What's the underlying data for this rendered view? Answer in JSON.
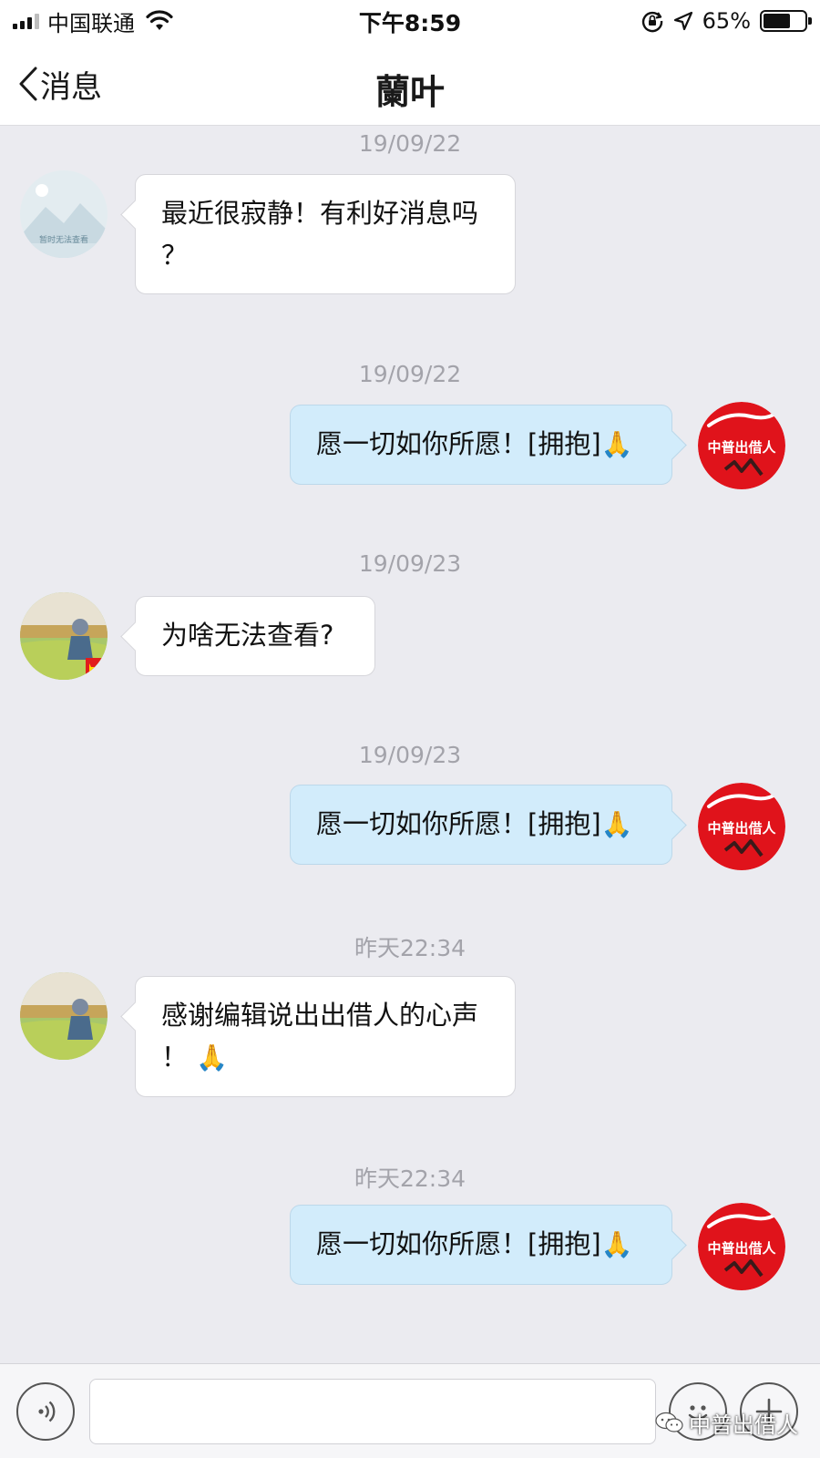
{
  "status_bar": {
    "carrier": "中国联通",
    "time": "下午8:59",
    "battery_percent": "65%",
    "battery_level": 0.65
  },
  "nav": {
    "back_label": "消息",
    "title": "蘭叶"
  },
  "messages": [
    {
      "timestamp": "19/09/22",
      "direction": "incoming",
      "avatar": "placeholder-image-avatar",
      "avatar_text": "暂时无法查看",
      "lines": [
        "最近很寂静！有利好消息吗",
        "？"
      ]
    },
    {
      "timestamp": "19/09/22",
      "direction": "outgoing",
      "avatar": "red-logo-avatar",
      "lines": [
        "愿一切如你所愿！[拥抱]"
      ],
      "emoji": "🙏"
    },
    {
      "timestamp": "19/09/23",
      "direction": "incoming",
      "avatar": "wheat-field-avatar",
      "lines": [
        "为啥无法查看?"
      ]
    },
    {
      "timestamp": "19/09/23",
      "direction": "outgoing",
      "avatar": "red-logo-avatar",
      "lines": [
        "愿一切如你所愿！[拥抱]"
      ],
      "emoji": "🙏"
    },
    {
      "timestamp": "昨天22:34",
      "direction": "incoming",
      "avatar": "wheat-field-avatar",
      "lines": [
        "感谢编辑说出出借人的心声",
        "！"
      ],
      "emoji": "🙏"
    },
    {
      "timestamp": "昨天22:34",
      "direction": "outgoing",
      "avatar": "red-logo-avatar",
      "lines": [
        "愿一切如你所愿！[拥抱]"
      ],
      "emoji": "🙏"
    }
  ],
  "logo_text": "中普出借人",
  "input_bar": {
    "placeholder": "",
    "watermark": "中普出借人"
  },
  "colors": {
    "chat_background": "#ebebf0",
    "outgoing_bubble": "#d2ecfb",
    "incoming_bubble": "#ffffff",
    "logo_red": "#e0131b"
  }
}
